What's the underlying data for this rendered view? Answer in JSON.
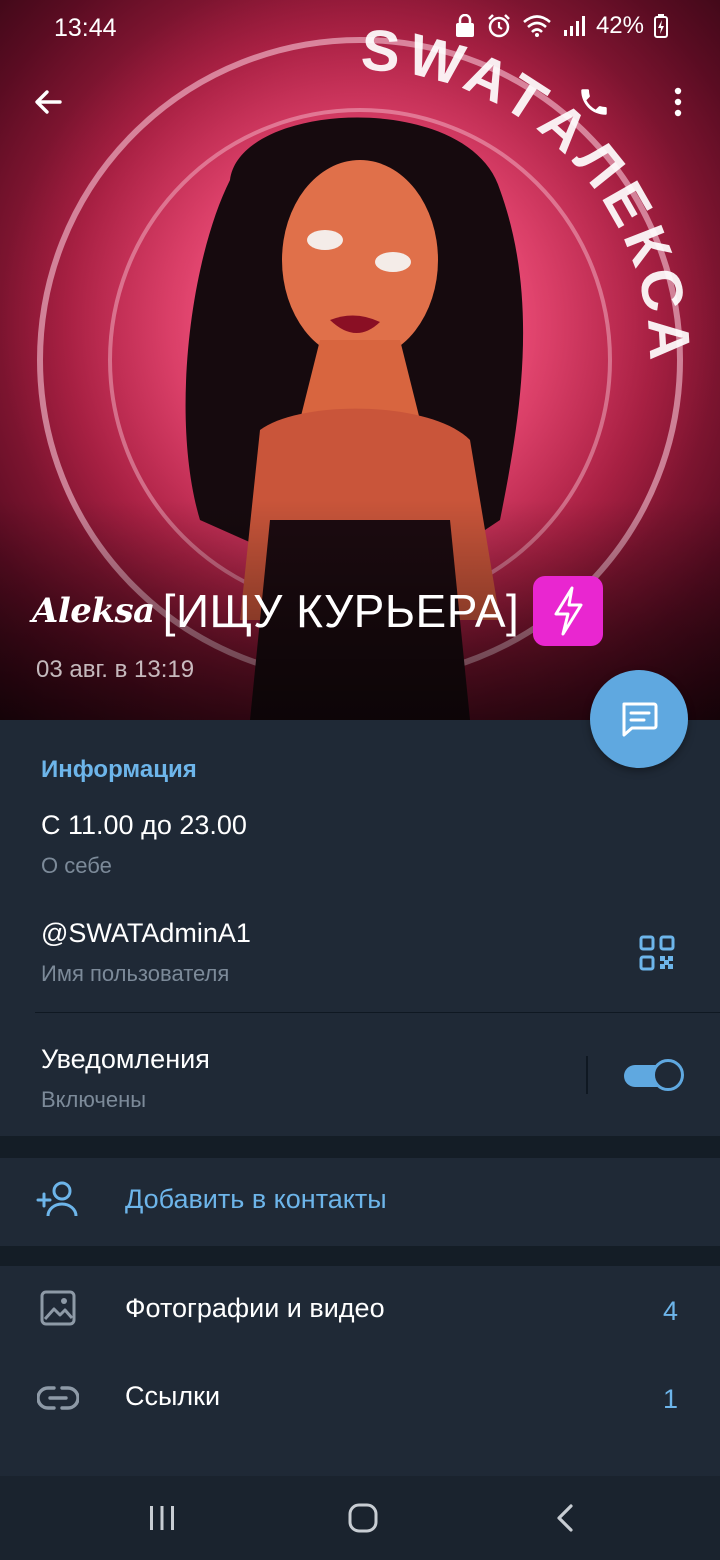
{
  "status_bar": {
    "time": "13:44",
    "battery": "42%"
  },
  "header": {
    "avatar_ring_text": "SWATАЛЕКСА",
    "name_script": "Aleksa",
    "name_main": "[ИЩУ КУРЬЕРА]",
    "last_seen": "03 авг. в 13:19"
  },
  "info": {
    "title": "Информация",
    "bio_value": "С 11.00 до 23.00",
    "bio_label": "О себе",
    "username_value": "@SWATAdminA1",
    "username_label": "Имя пользователя",
    "notifications_value": "Уведомления",
    "notifications_label": "Включены",
    "notifications_on": true
  },
  "actions": {
    "add_contact": "Добавить в контакты"
  },
  "media": {
    "items": [
      {
        "label": "Фотографии и видео",
        "count": "4",
        "icon": "image-icon"
      },
      {
        "label": "Ссылки",
        "count": "1",
        "icon": "link-icon"
      }
    ]
  },
  "colors": {
    "accent": "#5fa8e0",
    "accent_text": "#6db5ea",
    "background": "#1f2936",
    "badge": "#e926d0"
  }
}
